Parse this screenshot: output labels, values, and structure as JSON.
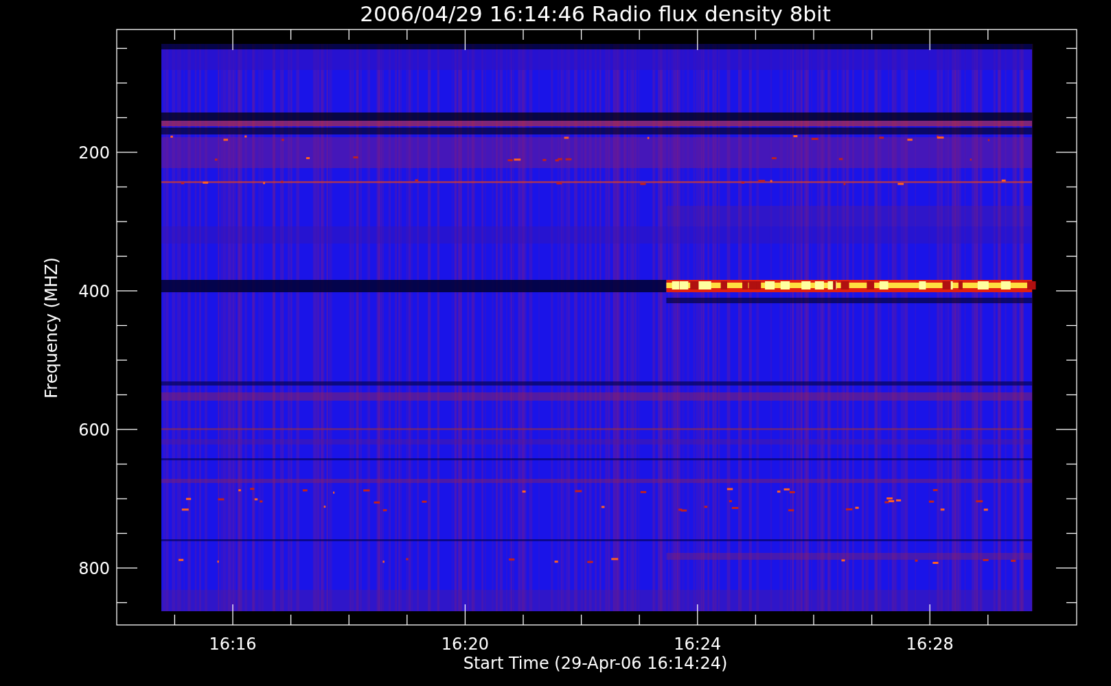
{
  "title": "2006/04/29 16:14:46 Radio flux density 8bit",
  "y_axis": {
    "label": "Frequency (MHZ)",
    "ticks": [
      "200",
      "400",
      "600",
      "800"
    ]
  },
  "x_axis": {
    "label": "Start Time (29-Apr-06 16:14:24)",
    "ticks": [
      "16:16",
      "16:20",
      "16:24",
      "16:28"
    ]
  }
}
